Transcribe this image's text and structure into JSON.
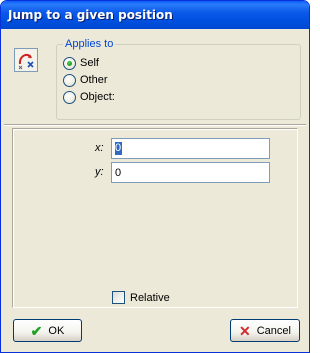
{
  "window": {
    "title": "Jump to a given position"
  },
  "applies_to": {
    "legend": "Applies to",
    "options": [
      {
        "label": "Self",
        "checked": true
      },
      {
        "label": "Other",
        "checked": false
      },
      {
        "label": "Object:",
        "checked": false
      }
    ]
  },
  "args": {
    "x_label": "x:",
    "x_value": "0",
    "y_label": "y:",
    "y_value": "0",
    "relative_label": "Relative",
    "relative_checked": false
  },
  "buttons": {
    "ok": "OK",
    "cancel": "Cancel"
  },
  "icons": {
    "action": "jump-arrow-icon",
    "ok": "checkmark-icon",
    "cancel": "red-x-icon"
  },
  "colors": {
    "title_bar": "#0054e3",
    "legend_text": "#0046d5",
    "radio_dot": "#21a121",
    "ok_check": "#21a121",
    "cancel_x": "#d22b2b",
    "selection": "#316ac5"
  }
}
